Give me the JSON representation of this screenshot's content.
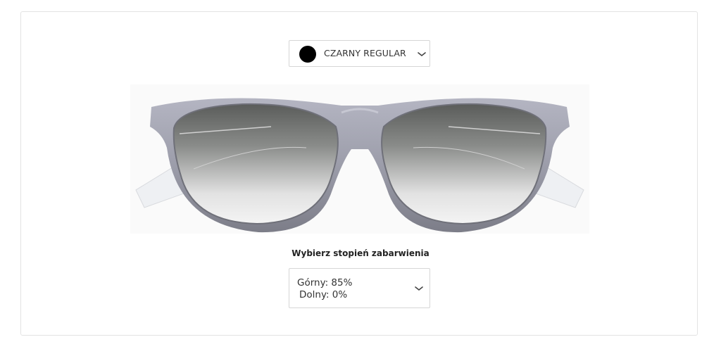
{
  "color_selector": {
    "swatch_color": "#000000",
    "label": "CZARNY REGULAR",
    "icon": "chevron-down-icon"
  },
  "product_image": {
    "icon": "sunglasses-image",
    "frame_color": "#8e8f99",
    "lens_tint": "gradient-grey"
  },
  "tint": {
    "title": "Wybierz stopień zabarwienia",
    "upper": "Górny: 85%",
    "lower": "Dolny: 0%",
    "icon": "chevron-down-icon"
  }
}
